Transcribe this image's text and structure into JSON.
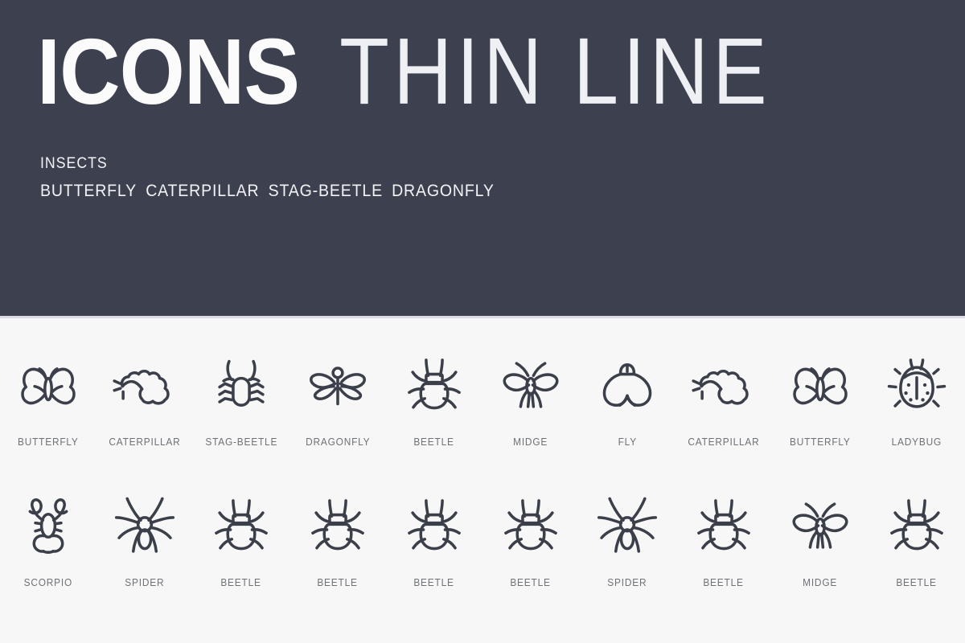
{
  "header": {
    "title_bold": "ICONS",
    "title_thin": "THIN LINE",
    "category": "INSECTS",
    "keywords": [
      "BUTTERFLY",
      "CATERPILLAR",
      "STAG-BEETLE",
      "DRAGONFLY"
    ],
    "keywords_text": "BUTTERFLY  CATERPILLAR  STAG-BEETLE  DRAGONFLY",
    "background_color": "#3d414f",
    "text_color": "#f7f8fa",
    "divider_color": "#dedbe6"
  },
  "grid": {
    "background_color": "#f7f7f8",
    "icon_stroke_color": "#3b3f4a",
    "label_color": "#6e7177",
    "columns": 10,
    "rows": 2,
    "rows_data": [
      {
        "cells": [
          {
            "icon": "butterfly-icon",
            "label": "BUTTERFLY"
          },
          {
            "icon": "caterpillar-icon",
            "label": "CATERPILLAR"
          },
          {
            "icon": "stag-beetle-icon",
            "label": "STAG-BEETLE"
          },
          {
            "icon": "dragonfly-icon",
            "label": "DRAGONFLY"
          },
          {
            "icon": "beetle-icon",
            "label": "BEETLE"
          },
          {
            "icon": "midge-icon",
            "label": "MIDGE"
          },
          {
            "icon": "fly-icon",
            "label": "FLY"
          },
          {
            "icon": "caterpillar-icon",
            "label": "CATERPILLAR"
          },
          {
            "icon": "butterfly-icon",
            "label": "BUTTERFLY"
          },
          {
            "icon": "ladybug-icon",
            "label": "LADYBUG"
          }
        ]
      },
      {
        "cells": [
          {
            "icon": "scorpio-icon",
            "label": "SCORPIO"
          },
          {
            "icon": "spider-icon",
            "label": "SPIDER"
          },
          {
            "icon": "beetle-icon",
            "label": "BEETLE"
          },
          {
            "icon": "beetle-icon",
            "label": "BEETLE"
          },
          {
            "icon": "beetle-icon",
            "label": "BEETLE"
          },
          {
            "icon": "beetle-icon",
            "label": "BEETLE"
          },
          {
            "icon": "spider-icon",
            "label": "SPIDER"
          },
          {
            "icon": "beetle-icon",
            "label": "BEETLE"
          },
          {
            "icon": "midge-icon",
            "label": "MIDGE"
          },
          {
            "icon": "beetle-icon",
            "label": "BEETLE"
          }
        ]
      }
    ]
  }
}
